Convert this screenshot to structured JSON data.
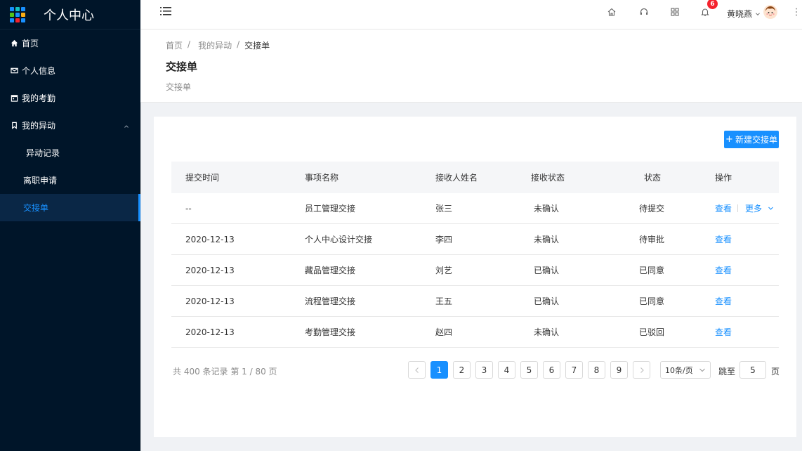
{
  "app": {
    "title": "个人中心",
    "grid_colors": [
      "#1890ff",
      "#13c2c2",
      "#1890ff",
      "#52c41a",
      "#1890ff",
      "#faad14",
      "#1890ff",
      "#f5222d",
      "#1890ff"
    ]
  },
  "sidebar": {
    "items": [
      {
        "label": "首页",
        "icon": "home-icon"
      },
      {
        "label": "个人信息",
        "icon": "mail-icon"
      },
      {
        "label": "我的考勤",
        "icon": "calendar-icon"
      },
      {
        "label": "我的异动",
        "icon": "bookmark-icon",
        "expanded": true
      }
    ],
    "sub_items": [
      {
        "label": "异动记录"
      },
      {
        "label": "离职申请"
      },
      {
        "label": "交接单",
        "active": true
      }
    ]
  },
  "header": {
    "notification_count": "6",
    "username": "黄晓燕",
    "icons": [
      "home-icon",
      "headset-icon",
      "apps-icon",
      "bell-icon"
    ]
  },
  "page": {
    "breadcrumb": [
      "首页",
      "我的异动",
      "交接单"
    ],
    "breadcrumb_sep": "/",
    "title": "交接单",
    "description": "交接单"
  },
  "toolbar": {
    "new_label": "新建交接单",
    "new_icon": "plus"
  },
  "table": {
    "columns": [
      "提交时间",
      "事项名称",
      "接收人姓名",
      "接收状态",
      "状态",
      "操作"
    ],
    "rows": [
      {
        "time": "--",
        "item": "员工管理交接",
        "receiver": "张三",
        "recv_status": "未确认",
        "status": "待提交",
        "action": "查看",
        "more": "更多"
      },
      {
        "time": "2020-12-13",
        "item": "个人中心设计交接",
        "receiver": "李四",
        "recv_status": "未确认",
        "status": "待审批",
        "action": "查看"
      },
      {
        "time": "2020-12-13",
        "item": "藏品管理交接",
        "receiver": "刘艺",
        "recv_status": "已确认",
        "status": "已同意",
        "action": "查看"
      },
      {
        "time": "2020-12-13",
        "item": "流程管理交接",
        "receiver": "王五",
        "recv_status": "已确认",
        "status": "已同意",
        "action": "查看"
      },
      {
        "time": "2020-12-13",
        "item": "考勤管理交接",
        "receiver": "赵四",
        "recv_status": "未确认",
        "status": "已驳回",
        "action": "查看"
      }
    ]
  },
  "pagination": {
    "total_text": "共 400 条记录 第 1 / 80 页",
    "pages": [
      "1",
      "2",
      "3",
      "4",
      "5",
      "6",
      "7",
      "8",
      "9"
    ],
    "current": "1",
    "page_size": "10条/页",
    "jump_label": "跳至",
    "jump_value": "5",
    "jump_suffix": "页"
  }
}
